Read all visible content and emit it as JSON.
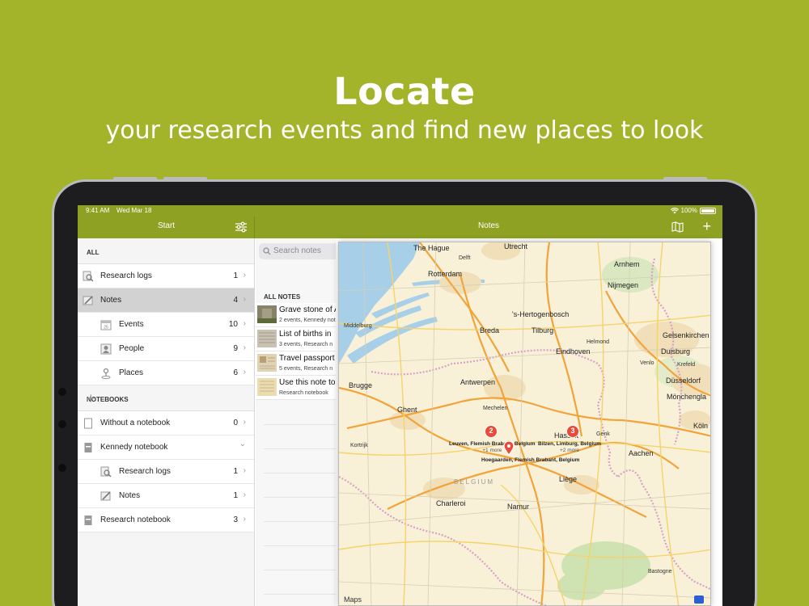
{
  "hero": {
    "title": "Locate",
    "subtitle": "your research events and find new places to look"
  },
  "status_bar": {
    "time": "9:41 AM",
    "date": "Wed Mar 18",
    "battery": "100%"
  },
  "left_nav": {
    "title": "Start",
    "filter_icon": "sliders-icon"
  },
  "right_nav": {
    "title": "Notes",
    "map_icon": "map-icon",
    "add_icon": "plus-icon",
    "add_label": "+"
  },
  "sidebar": {
    "all_header": "ALL",
    "items": [
      {
        "label": "Research logs",
        "count": "1",
        "icon": "magnifier-doc-icon"
      },
      {
        "label": "Notes",
        "count": "4",
        "icon": "pencil-icon"
      },
      {
        "label": "Events",
        "count": "10",
        "icon": "calendar-icon"
      },
      {
        "label": "People",
        "count": "9",
        "icon": "person-icon"
      },
      {
        "label": "Places",
        "count": "6",
        "icon": "pin-icon"
      }
    ],
    "notebooks_header": "NOTEBOOKS",
    "notebooks_add": "+",
    "notebooks": [
      {
        "label": "Without a notebook",
        "count": "0",
        "icon": "notebook-empty-icon"
      },
      {
        "label": "Kennedy notebook",
        "count": "",
        "icon": "notebook-icon"
      },
      {
        "label": "Research logs",
        "count": "1",
        "icon": "magnifier-doc-icon"
      },
      {
        "label": "Notes",
        "count": "1",
        "icon": "pencil-icon"
      },
      {
        "label": "Research notebook",
        "count": "3",
        "icon": "notebook-icon"
      }
    ],
    "chevron": "›",
    "chevron_down": "⌄"
  },
  "notes_list": {
    "search_placeholder": "Search notes",
    "header": "ALL NOTES",
    "items": [
      {
        "title": "Grave stone of A",
        "sub": "2 events, Kennedy not"
      },
      {
        "title": "List of births in",
        "sub": "3 events, Research n"
      },
      {
        "title": "Travel passport",
        "sub": "5 events, Research n"
      },
      {
        "title": "Use this note to",
        "sub": "Research notebook"
      }
    ]
  },
  "map": {
    "labels": {
      "the_hague": "The Hague",
      "utrecht": "Utrecht",
      "rotterdam": "Rotterdam",
      "arnhem": "Arnhem",
      "nijmegen": "Nijmegen",
      "s_hertogenbosch": "'s-Hertogenbosch",
      "breda": "Breda",
      "tilburg": "Tilburg",
      "eindhoven": "Eindhoven",
      "duisburg": "Duisburg",
      "dusseldorf": "Düsseldorf",
      "monchenglad": "Mönchengla",
      "antwerpen": "Antwerpen",
      "brugge": "Brugge",
      "ghent": "Ghent",
      "hasselt": "Hasselt",
      "koln": "Köln",
      "aachen": "Aachen",
      "liege": "Liège",
      "namur": "Namur",
      "charleroi": "Charleroi",
      "belgium": "BELGIUM",
      "delft": "Delft",
      "middelburg": "Middelburg",
      "helmond": "Helmond",
      "venlo": "Venlo",
      "gelsenkirchen": "Gelsenkirchen",
      "krefeld": "Krefeld",
      "mechelen": "Mechelen",
      "kortrijk": "Kortrijk",
      "genk": "Genk",
      "bastogne": "Bastogne"
    },
    "pins": [
      {
        "count": "2",
        "label": "Leuven, Flemish Brabant, Belgium",
        "more": "+1 more"
      },
      {
        "count": "",
        "label": "Hoegaarden, Flemish Brabant, Belgium",
        "more": ""
      },
      {
        "count": "3",
        "label": "Bilzen, Limburg, Belgium",
        "more": "+2 more"
      }
    ],
    "attribution": "Maps"
  }
}
